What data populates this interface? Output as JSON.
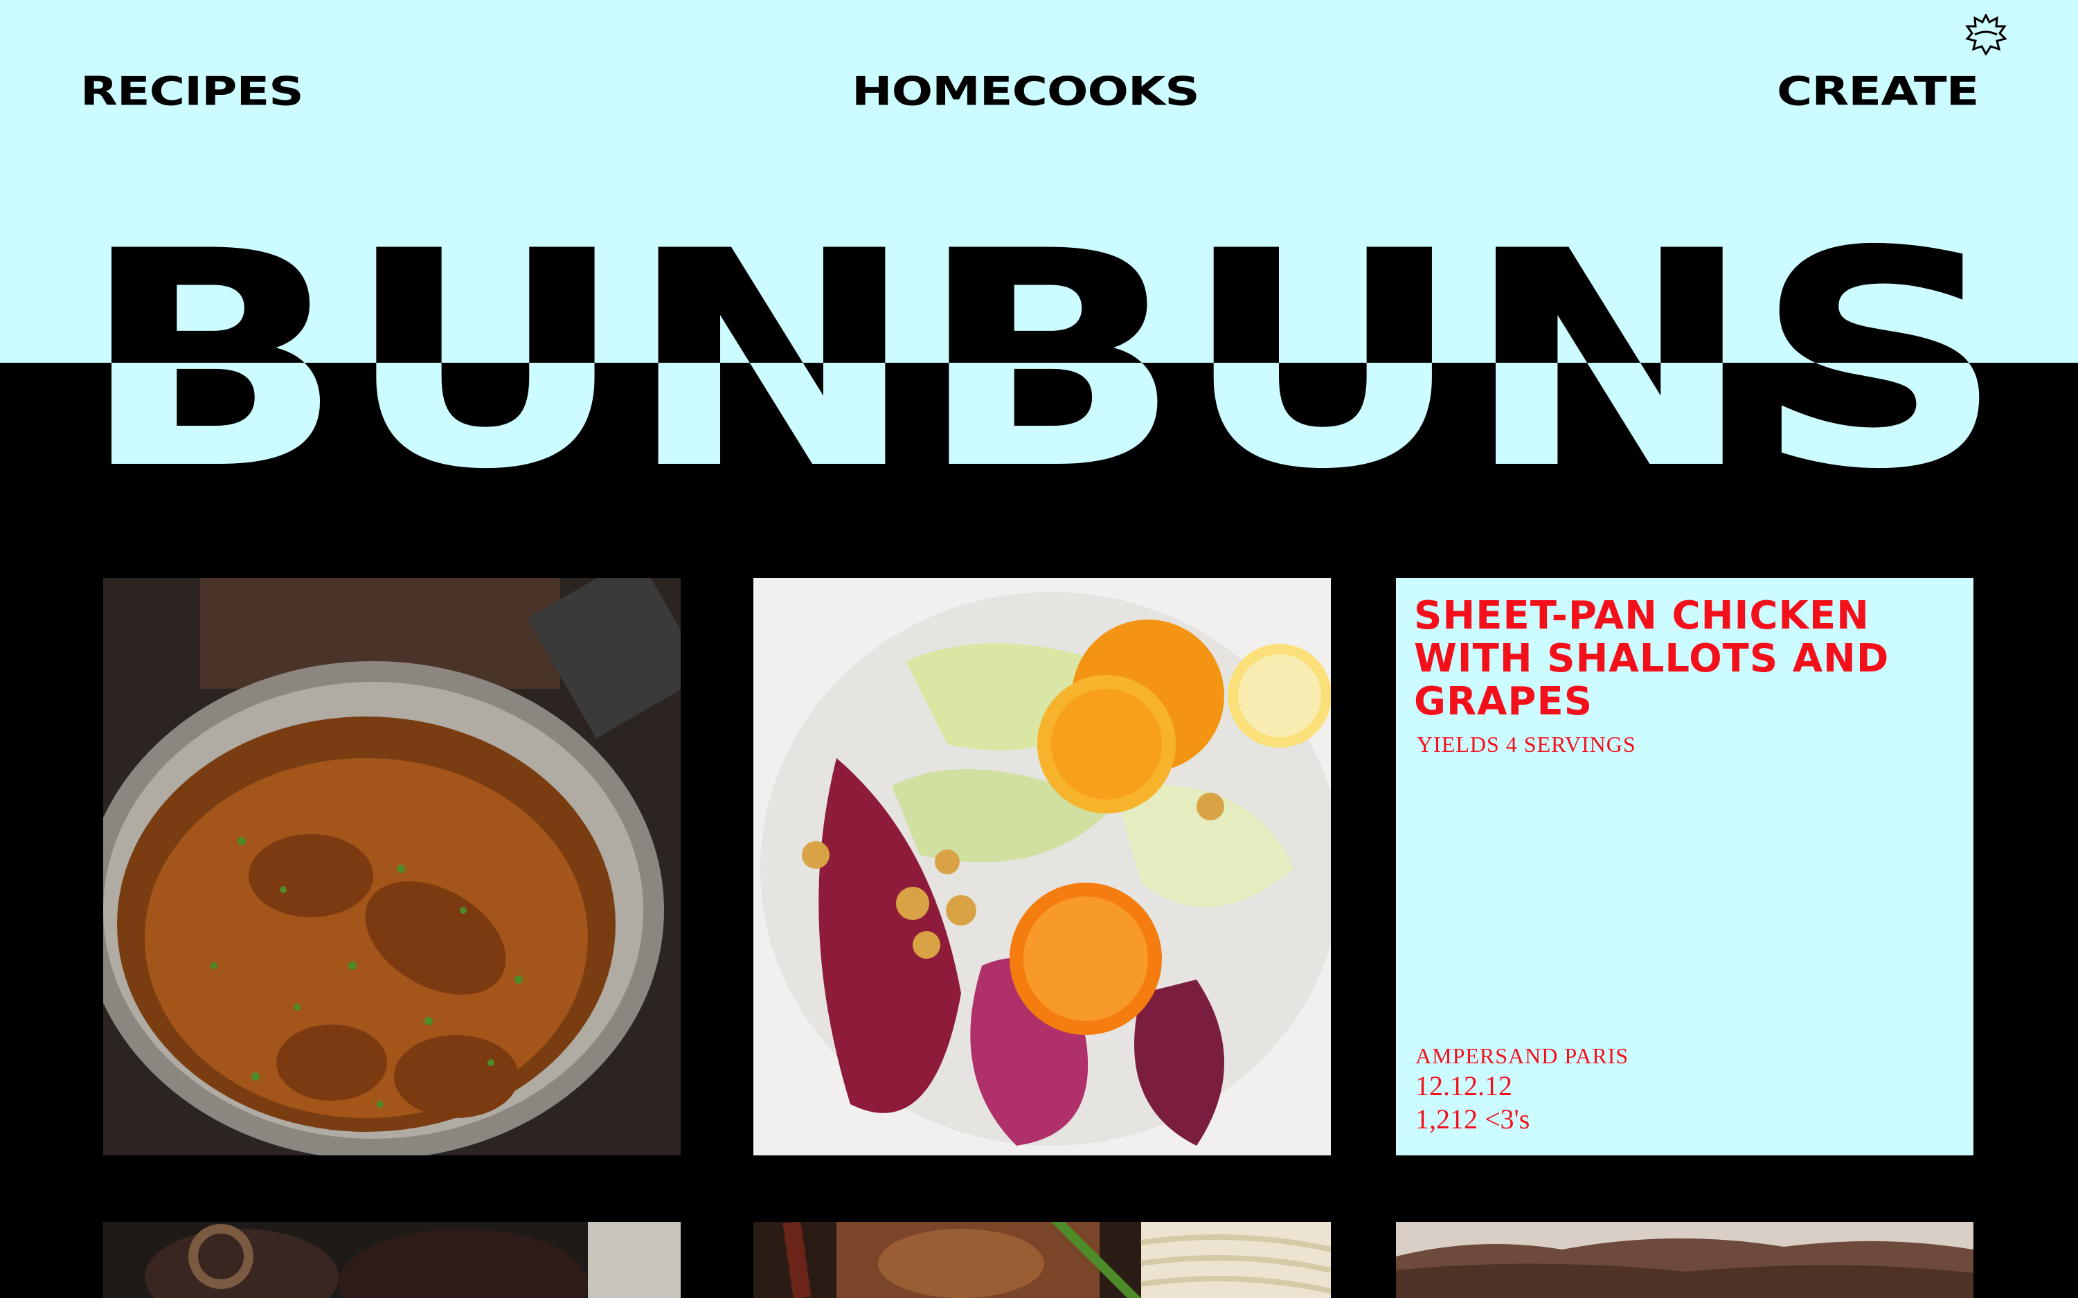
{
  "nav": {
    "recipes": "RECIPES",
    "homecooks": "HOMECOOKS",
    "create": "CREATE"
  },
  "logo": {
    "text": "BUNBUNS"
  },
  "colors": {
    "mint": "#ccfcff",
    "black": "#000000",
    "red": "#f3101b"
  },
  "cards": [
    {
      "kind": "image",
      "subject": "chicken curry in pot"
    },
    {
      "kind": "image",
      "subject": "radicchio citrus salad"
    },
    {
      "kind": "text",
      "title": "SHEET-PAN CHICKEN WITH SHALLOTS AND GRAPES",
      "yield": "YIELDS 4 SERVINGS",
      "author": "AMPERSAND PARIS",
      "date": "12.12.12",
      "hearts": "1,212 <3's"
    },
    {
      "kind": "image",
      "subject": "braised short ribs"
    },
    {
      "kind": "image",
      "subject": "noodle bowl with chopsticks"
    },
    {
      "kind": "image",
      "subject": "grilled dish"
    }
  ],
  "icons": {
    "badge": "starburst-badge-icon"
  }
}
